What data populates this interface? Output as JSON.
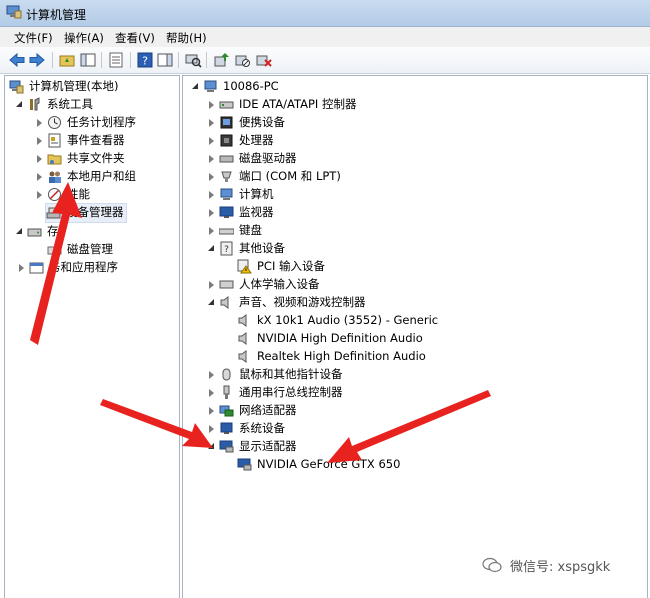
{
  "window": {
    "title": "计算机管理"
  },
  "menu": [
    "文件(F)",
    "操作(A)",
    "查看(V)",
    "帮助(H)"
  ],
  "left_tree": {
    "root": "计算机管理(本地)",
    "system_tools": "系统工具",
    "task_scheduler": "任务计划程序",
    "event_viewer": "事件查看器",
    "shared_folders": "共享文件夹",
    "local_users": "本地用户和组",
    "performance": "性能",
    "device_manager": "设备管理器",
    "storage_partial": "存",
    "disk_management": "磁盘管理",
    "services_partial": "务和应用程序"
  },
  "right_tree": {
    "computer": "10086-PC",
    "items": [
      "IDE ATA/ATAPI 控制器",
      "便携设备",
      "处理器",
      "磁盘驱动器",
      "端口 (COM 和 LPT)",
      "计算机",
      "监视器",
      "键盘",
      "其他设备",
      "PCI 输入设备",
      "人体学输入设备",
      "声音、视频和游戏控制器",
      "kX 10k1 Audio (3552) - Generic",
      "NVIDIA High Definition Audio",
      "Realtek High Definition Audio",
      "鼠标和其他指针设备",
      "通用串行总线控制器",
      "网络适配器",
      "系统设备",
      "显示适配器",
      "NVIDIA GeForce GTX 650"
    ]
  },
  "watermark": {
    "text": "微信号: xspsgkk"
  },
  "colors": {
    "arrow": "#e8231f",
    "title_bg": "#c9dcf0",
    "pane_border": "#a8b4c4"
  }
}
